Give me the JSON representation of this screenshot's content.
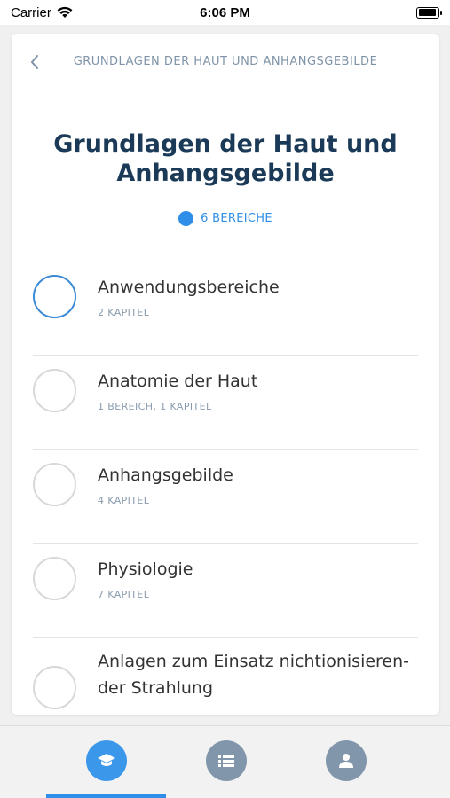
{
  "status_bar": {
    "carrier": "Carrier",
    "time": "6:06 PM"
  },
  "navbar": {
    "title": "GRUNDLAGEN DER HAUT UND ANHANGSGEBILDE"
  },
  "page": {
    "title": "Grundlagen der Haut und Anhangsgebilde",
    "count_label": "6 BEREICHE"
  },
  "items": [
    {
      "title": "Anwendungsbereiche",
      "subtitle": "2 KAPITEL"
    },
    {
      "title": "Anatomie der Haut",
      "subtitle": "1 BEREICH, 1 KAPITEL"
    },
    {
      "title": "Anhangsgebilde",
      "subtitle": "4 KAPITEL"
    },
    {
      "title": "Physiologie",
      "subtitle": "7 KAPITEL"
    },
    {
      "title": "Anlagen zum Einsatz nichtionisieren-der Strahlung",
      "subtitle": ""
    }
  ],
  "tabs": [
    {
      "icon": "graduation-cap-icon",
      "active": true
    },
    {
      "icon": "list-icon",
      "active": false
    },
    {
      "icon": "profile-icon",
      "active": false
    }
  ],
  "colors": {
    "accent": "#2f8ee7",
    "title": "#1b3a57",
    "muted": "#8296ab"
  }
}
